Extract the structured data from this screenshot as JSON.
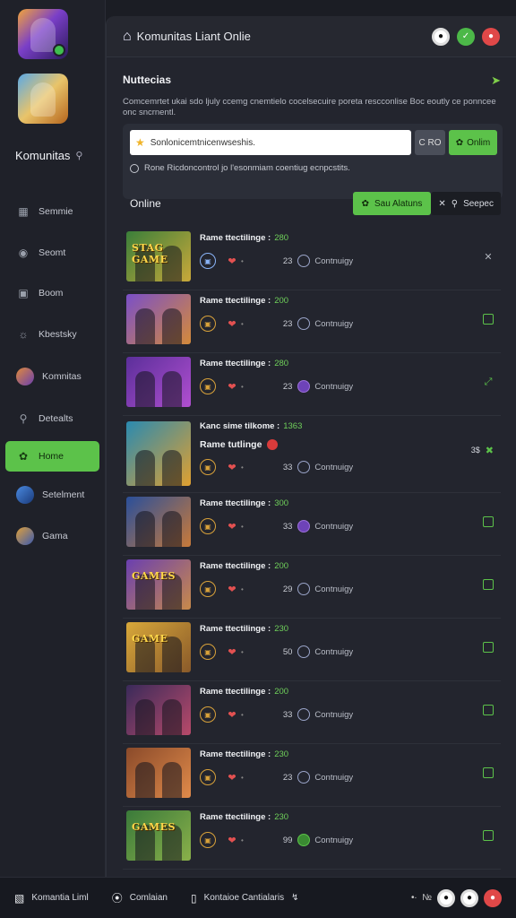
{
  "sidebar": {
    "title": "Komunitas",
    "items": [
      {
        "label": "Semmie",
        "icon": "tile-icon"
      },
      {
        "label": "Seomt",
        "icon": "shield-icon"
      },
      {
        "label": "Boom",
        "icon": "square-icon"
      },
      {
        "label": "Kbestsky",
        "icon": "chat-icon"
      },
      {
        "label": "Komnitas",
        "icon": "group-avatar"
      },
      {
        "label": "Detealts",
        "icon": "search-icon"
      },
      {
        "label": "Home",
        "icon": "leaf-icon",
        "active": true
      },
      {
        "label": "Setelment",
        "icon": "blue-avatar"
      },
      {
        "label": "Gama",
        "icon": "game-avatar"
      }
    ]
  },
  "header": {
    "title": "Komunitas Liant Onlie"
  },
  "notice": {
    "title": "Nuttecias",
    "description": "Comcemrtet ukai sdo ljuly ccemg cnemtielo cocelsecuire poreta rescconlise Boc eoutly ce ponncee onc sncrnentl."
  },
  "search": {
    "placeholder": "Sonlonicemtnicenwseshis.",
    "button1": "C RO",
    "button2": "Onlim",
    "hint": "Rone Ricdoncontrol jo l'esonmiam coentiug ecnpcstits."
  },
  "online_bar": {
    "label": "Online",
    "primary_button": "Sau Alatuns",
    "secondary_button": "Seepec"
  },
  "rows": [
    {
      "title": "Rame ttectilinge :",
      "points": "280",
      "count": "23",
      "category": "Contnuigy",
      "thumb_text": "STAG GAME",
      "action": "close-icon",
      "colors": [
        "#3a7f3a",
        "#c9a83a"
      ]
    },
    {
      "title": "Rame ttectilinge :",
      "points": "200",
      "count": "23",
      "category": "Contnuigy",
      "thumb_text": "",
      "action": "checkbox-icon",
      "colors": [
        "#7a4fc8",
        "#d48a3a"
      ]
    },
    {
      "title": "Rame ttectilinge :",
      "points": "280",
      "count": "23",
      "category": "Contnuigy",
      "thumb_text": "",
      "action": "expand-icon",
      "colors": [
        "#5b2f9a",
        "#b04fd0"
      ]
    },
    {
      "title": "Kanc sime tilkome :",
      "points": "1363",
      "subtitle": "Rame tutlinge",
      "count": "33",
      "category": "Contnuigy",
      "thumb_text": "",
      "action": "collapse-icon",
      "action_text": "3$",
      "tall": true,
      "colors": [
        "#2a8ab0",
        "#e0a030"
      ]
    },
    {
      "title": "Rame ttectilinge :",
      "points": "300",
      "count": "33",
      "category": "Contnuigy",
      "thumb_text": "",
      "action": "checkbox-icon",
      "colors": [
        "#2a4f9a",
        "#c87a3a"
      ]
    },
    {
      "title": "Rame ttectilinge :",
      "points": "200",
      "count": "29",
      "category": "Contnuigy",
      "thumb_text": "GAMES",
      "action": "checkbox-icon",
      "colors": [
        "#6a3fb0",
        "#c88a4a"
      ]
    },
    {
      "title": "Rame ttectilinge :",
      "points": "230",
      "count": "50",
      "category": "Contnuigy",
      "thumb_text": "GAME",
      "action": "checkbox-icon",
      "colors": [
        "#d8a83a",
        "#8a5a2a"
      ]
    },
    {
      "title": "Rame ttectilinge :",
      "points": "200",
      "count": "33",
      "category": "Contnuigy",
      "thumb_text": "",
      "action": "checkbox-icon",
      "colors": [
        "#3a2a5a",
        "#b84a6a"
      ]
    },
    {
      "title": "Rame ttectilinge :",
      "points": "230",
      "count": "23",
      "category": "Contnuigy",
      "thumb_text": "",
      "action": "checkbox-icon",
      "colors": [
        "#8a4a2a",
        "#e08a4a"
      ]
    },
    {
      "title": "Rame ttectilinge :",
      "points": "230",
      "count": "99",
      "category": "Contnuigy",
      "thumb_text": "GAMES",
      "action": "checkbox-icon",
      "colors": [
        "#3a7a3a",
        "#8ab04a"
      ]
    }
  ],
  "bottom_bar": {
    "item1": "Komantia Liml",
    "item2": "Comlaian",
    "item3": "Kontaioe Cantialaris"
  },
  "colors": {
    "accent_green": "#5cc24a",
    "danger_red": "#e04848",
    "background": "#1b1d24"
  }
}
